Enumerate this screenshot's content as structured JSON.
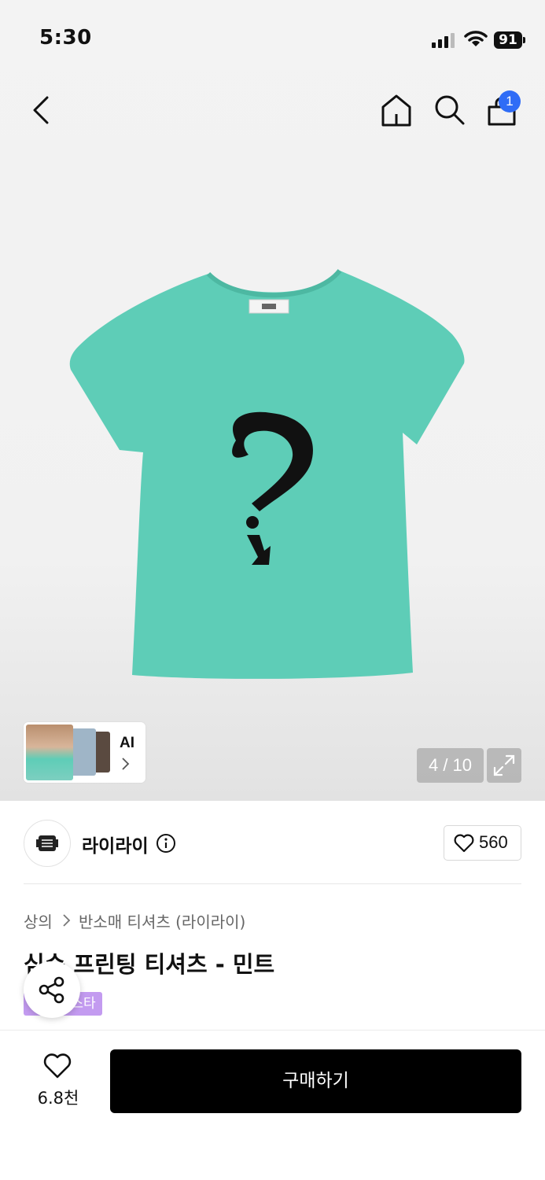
{
  "status_bar": {
    "time": "5:30",
    "battery": "91"
  },
  "nav": {
    "cart_count": "1"
  },
  "gallery": {
    "ai_label": "AI",
    "counter": "4 / 10"
  },
  "brand": {
    "name": "라이라이",
    "likes": "560"
  },
  "breadcrumb": {
    "category": "상의",
    "subcategory": "반소매 티셔츠 (라이라이)"
  },
  "product": {
    "title": "심슨 프린팅 티셔츠 - 민트",
    "badge": "패션 페스타",
    "color_hex": "#5ecdb7"
  },
  "bottom_bar": {
    "wish_count": "6.8천",
    "buy_label": "구매하기"
  }
}
